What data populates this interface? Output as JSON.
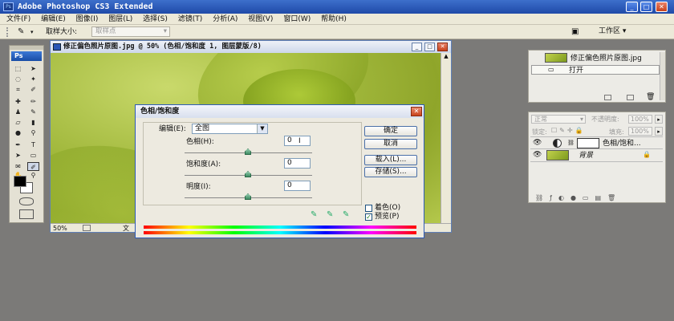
{
  "app": {
    "title": "Adobe Photoshop CS3 Extended",
    "icon": "ps-app-icon"
  },
  "window_controls": {
    "minimize": "_",
    "maximize": "□",
    "close": "✕"
  },
  "menu": [
    "文件(F)",
    "编辑(E)",
    "图像(I)",
    "图层(L)",
    "选择(S)",
    "滤镜(T)",
    "分析(A)",
    "视图(V)",
    "窗口(W)",
    "帮助(H)"
  ],
  "options_bar": {
    "sample_size_label": "取样大小:",
    "sample_size_value": "取样点",
    "workspace_label": "工作区"
  },
  "toolbox": {
    "logo": "Ps"
  },
  "document": {
    "title": "修正偏色照片原图.jpg @ 50% (色相/饱和度 1, 图层蒙版/8)",
    "zoom": "50%",
    "status_partial": "文"
  },
  "history_panel": {
    "doc_name": "修正偏色照片原图.jpg",
    "open_label": "打开"
  },
  "layers_panel": {
    "blend_mode": "正常",
    "opacity_label": "不透明度:",
    "opacity_value": "100%",
    "lock_label": "锁定:",
    "fill_label": "填充:",
    "fill_value": "100%",
    "layers": [
      {
        "name": "色相/饱和..."
      },
      {
        "name": "背景"
      }
    ]
  },
  "dialog": {
    "title": "色相/饱和度",
    "close": "✕",
    "edit_label": "编辑(E):",
    "edit_value": "全图",
    "hue": {
      "label": "色相(H):",
      "value": "0"
    },
    "saturation": {
      "label": "饱和度(A):",
      "value": "0"
    },
    "lightness": {
      "label": "明度(I):",
      "value": "0"
    },
    "buttons": {
      "ok": "确定",
      "cancel": "取消",
      "load": "载入(L)...",
      "save": "存储(S)..."
    },
    "colorize": {
      "label": "着色(O)",
      "checked": false
    },
    "preview": {
      "label": "预览(P)",
      "checked": true
    },
    "check_mark": "✓"
  }
}
